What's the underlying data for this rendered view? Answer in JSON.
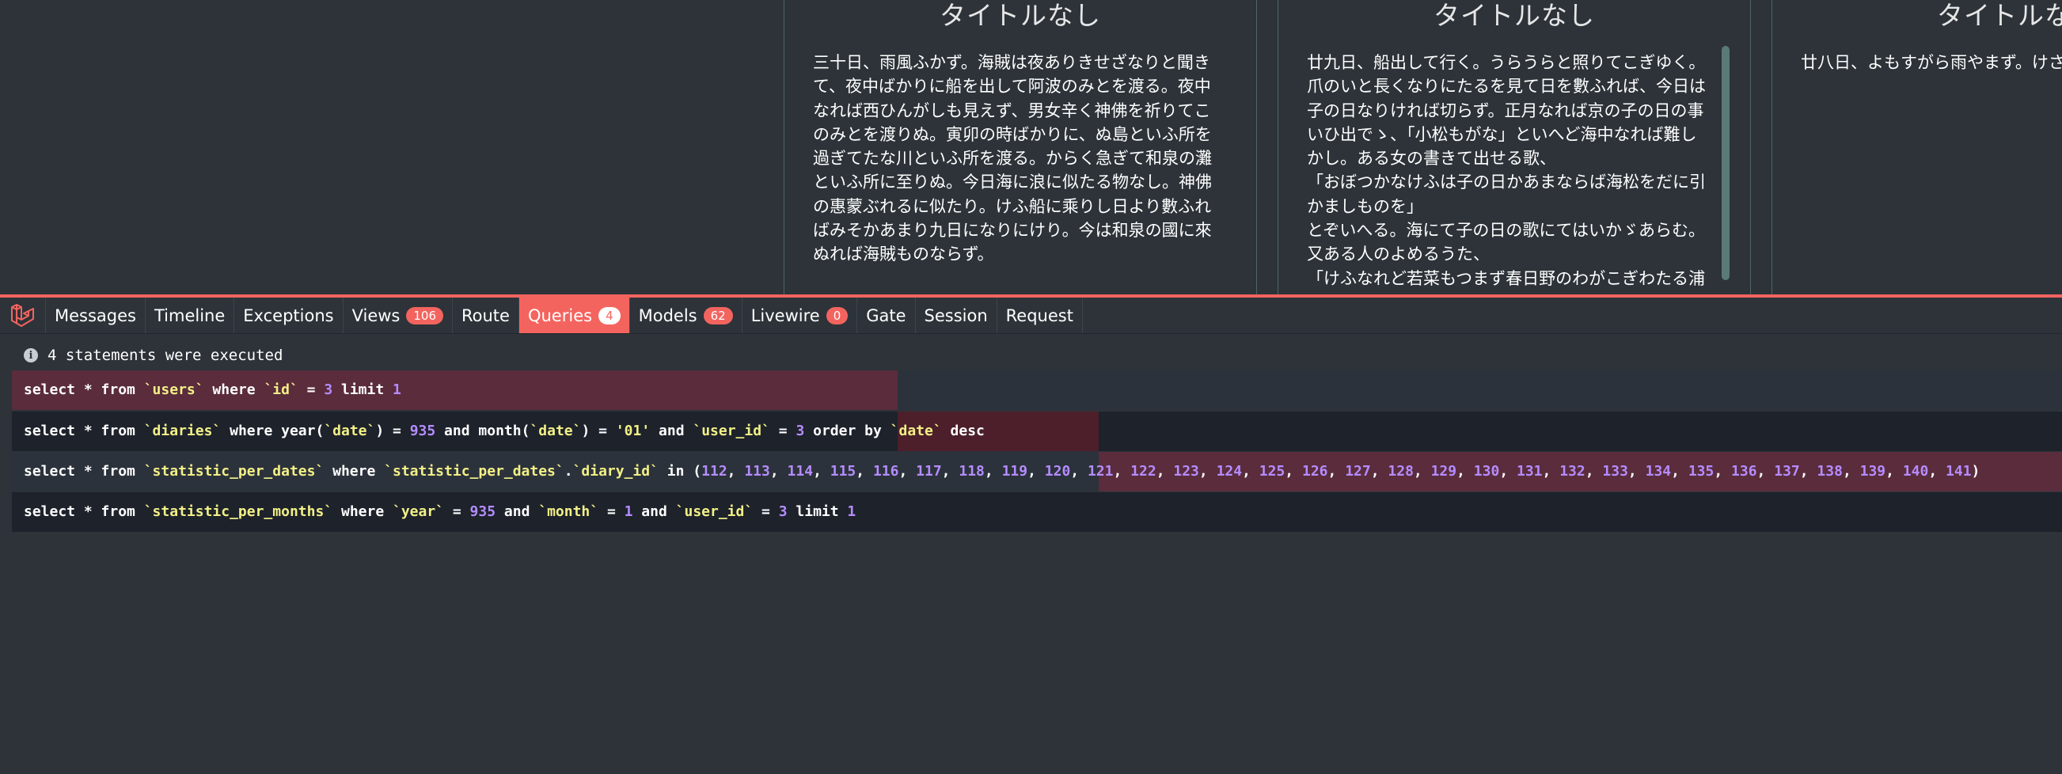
{
  "diary": {
    "cards": [
      {
        "title": "タイトルなし",
        "body": "三十日、雨風ふかず。海賊は夜ありきせざなりと聞きて、夜中ばかりに船を出して阿波のみとを渡る。夜中なれば西ひんがしも見えず、男女辛く神佛を祈りてこのみとを渡りぬ。寅卯の時ばかりに、ぬ島といふ所を過ぎてたな川といふ所を渡る。からく急ぎて和泉の灘といふ所に至りぬ。今日海に浪に似たる物なし。神佛の惠蒙ぶれるに似たり。けふ船に乘りし日より數ふればみそかあまり九日になりにけり。今は和泉の國に來ぬれば海賊ものならず。"
      },
      {
        "title": "タイトルなし",
        "body": "廿九日、船出して行く。うらうらと照りてこぎゆく。爪のいと長くなりにたるを見て日を數ふれば、今日は子の日なりければ切らず。正月なれば京の子の日の事いひ出でゝ、「小松もがな」といへど海中なれば難しかし。ある女の書きて出せる歌、\n「おぼつかなけふは子の日かあまならば海松をだに引かましものを」\nとぞいへる。海にて子の日の歌にてはいかゞあらむ。又ある人のよめるうた、\n「けふなれど若菜もつまず春日野のわがこぎわたる浦"
      },
      {
        "title": "タイトルなし",
        "body": "廿八日、よもすがら雨やまず。けさ"
      }
    ]
  },
  "debugbar": {
    "tabs": [
      {
        "label": "Messages"
      },
      {
        "label": "Timeline"
      },
      {
        "label": "Exceptions"
      },
      {
        "label": "Views",
        "badge": "106"
      },
      {
        "label": "Route"
      },
      {
        "label": "Queries",
        "badge": "4",
        "active": true
      },
      {
        "label": "Models",
        "badge": "62"
      },
      {
        "label": "Livewire",
        "badge": "0"
      },
      {
        "label": "Gate"
      },
      {
        "label": "Session"
      },
      {
        "label": "Request"
      }
    ],
    "status": "4 statements were executed",
    "queries": [
      {
        "timebar": {
          "start": 0.0,
          "duration": 0.432
        },
        "tokens": [
          [
            "kw",
            "select * from "
          ],
          [
            "tbl",
            "`users`"
          ],
          [
            "kw",
            " where "
          ],
          [
            "tbl",
            "`id`"
          ],
          [
            "kw",
            " = "
          ],
          [
            "num",
            "3"
          ],
          [
            "kw",
            " limit "
          ],
          [
            "num",
            "1"
          ]
        ]
      },
      {
        "timebar": {
          "start": 0.432,
          "duration": 0.098
        },
        "tokens": [
          [
            "kw",
            "select * from "
          ],
          [
            "tbl",
            "`diaries`"
          ],
          [
            "kw",
            " where year("
          ],
          [
            "tbl",
            "`date`"
          ],
          [
            "kw",
            ") = "
          ],
          [
            "num",
            "935"
          ],
          [
            "kw",
            " and month("
          ],
          [
            "tbl",
            "`date`"
          ],
          [
            "kw",
            ") = "
          ],
          [
            "str",
            "'01'"
          ],
          [
            "kw",
            " and "
          ],
          [
            "tbl",
            "`user_id`"
          ],
          [
            "kw",
            " = "
          ],
          [
            "num",
            "3"
          ],
          [
            "kw",
            " order by "
          ],
          [
            "tbl",
            "`date`"
          ],
          [
            "kw",
            " desc"
          ]
        ]
      },
      {
        "timebar": {
          "start": 0.53,
          "duration": 0.47
        },
        "tokens": [
          [
            "kw",
            "select * from "
          ],
          [
            "tbl",
            "`statistic_per_dates`"
          ],
          [
            "kw",
            " where "
          ],
          [
            "tbl",
            "`statistic_per_dates`"
          ],
          [
            "kw",
            "."
          ],
          [
            "tbl",
            "`diary_id`"
          ],
          [
            "kw",
            " in ("
          ],
          [
            "num",
            "112"
          ],
          [
            "kw",
            ", "
          ],
          [
            "num",
            "113"
          ],
          [
            "kw",
            ", "
          ],
          [
            "num",
            "114"
          ],
          [
            "kw",
            ", "
          ],
          [
            "num",
            "115"
          ],
          [
            "kw",
            ", "
          ],
          [
            "num",
            "116"
          ],
          [
            "kw",
            ", "
          ],
          [
            "num",
            "117"
          ],
          [
            "kw",
            ", "
          ],
          [
            "num",
            "118"
          ],
          [
            "kw",
            ", "
          ],
          [
            "num",
            "119"
          ],
          [
            "kw",
            ", "
          ],
          [
            "num",
            "120"
          ],
          [
            "kw",
            ", "
          ],
          [
            "num",
            "121"
          ],
          [
            "kw",
            ", "
          ],
          [
            "num",
            "122"
          ],
          [
            "kw",
            ", "
          ],
          [
            "num",
            "123"
          ],
          [
            "kw",
            ", "
          ],
          [
            "num",
            "124"
          ],
          [
            "kw",
            ", "
          ],
          [
            "num",
            "125"
          ],
          [
            "kw",
            ", "
          ],
          [
            "num",
            "126"
          ],
          [
            "kw",
            ", "
          ],
          [
            "num",
            "127"
          ],
          [
            "kw",
            ", "
          ],
          [
            "num",
            "128"
          ],
          [
            "kw",
            ", "
          ],
          [
            "num",
            "129"
          ],
          [
            "kw",
            ", "
          ],
          [
            "num",
            "130"
          ],
          [
            "kw",
            ", "
          ],
          [
            "num",
            "131"
          ],
          [
            "kw",
            ", "
          ],
          [
            "num",
            "132"
          ],
          [
            "kw",
            ", "
          ],
          [
            "num",
            "133"
          ],
          [
            "kw",
            ", "
          ],
          [
            "num",
            "134"
          ],
          [
            "kw",
            ", "
          ],
          [
            "num",
            "135"
          ],
          [
            "kw",
            ", "
          ],
          [
            "num",
            "136"
          ],
          [
            "kw",
            ", "
          ],
          [
            "num",
            "137"
          ],
          [
            "kw",
            ", "
          ],
          [
            "num",
            "138"
          ],
          [
            "kw",
            ", "
          ],
          [
            "num",
            "139"
          ],
          [
            "kw",
            ", "
          ],
          [
            "num",
            "140"
          ],
          [
            "kw",
            ", "
          ],
          [
            "num",
            "141"
          ],
          [
            "kw",
            ")"
          ]
        ]
      },
      {
        "timebar": null,
        "tokens": [
          [
            "kw",
            "select * from "
          ],
          [
            "tbl",
            "`statistic_per_months`"
          ],
          [
            "kw",
            " where "
          ],
          [
            "tbl",
            "`year`"
          ],
          [
            "kw",
            " = "
          ],
          [
            "num",
            "935"
          ],
          [
            "kw",
            " and "
          ],
          [
            "tbl",
            "`month`"
          ],
          [
            "kw",
            " = "
          ],
          [
            "num",
            "1"
          ],
          [
            "kw",
            " and "
          ],
          [
            "tbl",
            "`user_id`"
          ],
          [
            "kw",
            " = "
          ],
          [
            "num",
            "3"
          ],
          [
            "kw",
            " limit "
          ],
          [
            "num",
            "1"
          ]
        ]
      }
    ],
    "colors": {
      "accent": "#f4645f",
      "timebar": "#5a2c3c",
      "timebar_alt": "#4c1f2a"
    }
  }
}
